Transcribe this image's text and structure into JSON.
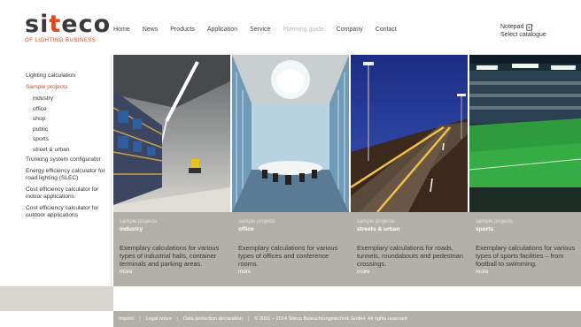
{
  "brand": {
    "logo_text_prefix": "si",
    "logo_text_accent": "t",
    "logo_text_suffix": "eco",
    "tagline": "OF LIGHTING BUSINESS"
  },
  "topnav": [
    {
      "label": "Home",
      "dim": false
    },
    {
      "label": "News",
      "dim": false
    },
    {
      "label": "Products",
      "dim": false
    },
    {
      "label": "Application",
      "dim": false
    },
    {
      "label": "Service",
      "dim": false
    },
    {
      "label": "Planning guide",
      "dim": true
    },
    {
      "label": "Company",
      "dim": false
    },
    {
      "label": "Contact",
      "dim": false
    }
  ],
  "notepad": {
    "label": "Notepad",
    "catalogue": "Select catalogue"
  },
  "sidebar": {
    "lighting_calc": "Lighting calculation",
    "sample_projects": "Sample projects",
    "subitems": [
      "industry",
      "office",
      "shop",
      "public",
      "sports",
      "street & urban"
    ],
    "others": [
      "Trunking system configurator",
      "Energy efficiency calculator for road lighting (SLEC)",
      "Cost efficiency calculator for indoor applications",
      "Cost efficiency calculator for outdoor applications"
    ]
  },
  "columns": [
    {
      "category": "sample projects",
      "title": "industry",
      "desc": "Exemplary calculations for various types of industrial halls, container terminals and parking areas.",
      "more": "more"
    },
    {
      "category": "sample projects",
      "title": "office",
      "desc": "Exemplary calculations for various types of offices and conference rooms.",
      "more": "more"
    },
    {
      "category": "sample projects",
      "title": "streets & urban",
      "desc": "Exemplary calculations for roads, tunnels, roundabouts and pedestrian crossings.",
      "more": "more"
    },
    {
      "category": "sample projects",
      "title": "sports",
      "desc": "Exemplary calculations for various types of sports facilities – from football to swimming.",
      "more": "more"
    }
  ],
  "footer": {
    "imprint": "Imprint",
    "legal": "Legal notes",
    "privacy": "Data protection declaration",
    "copyright": "© 2001 – 2014 Siteco Beleuchtungstechnik GmbH. All rights reserved"
  },
  "colors": {
    "accent": "#e0481f",
    "band": "#b3b0a9"
  }
}
